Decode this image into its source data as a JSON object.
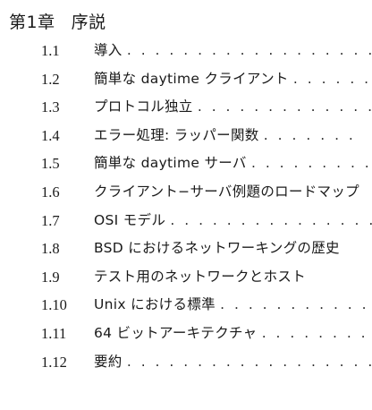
{
  "chapter": {
    "number": "第1章",
    "title": "序説"
  },
  "toc": {
    "items": [
      {
        "number": "1.1",
        "title": "導入",
        "dots": ". . . . . . . . . . . . . . . . . . . ."
      },
      {
        "number": "1.2",
        "title": "簡単な daytime クライアント",
        "dots": ". . . . . ."
      },
      {
        "number": "1.3",
        "title": "プロトコル独立",
        "dots": ". . . . . . . . . . . . . . ."
      },
      {
        "number": "1.4",
        "title": "エラー処理: ラッパー関数",
        "dots": ". . . . . . ."
      },
      {
        "number": "1.5",
        "title": "簡単な daytime サーバ",
        "dots": ". . . . . . . . . . ."
      },
      {
        "number": "1.6",
        "title": "クライアント−サーバ例題のロードマップ",
        "dots": ""
      },
      {
        "number": "1.7",
        "title": "OSI モデル",
        "dots": ". . . . . . . . . . . . . . . . . ."
      },
      {
        "number": "1.8",
        "title": "BSD におけるネットワーキングの歴史",
        "dots": ""
      },
      {
        "number": "1.9",
        "title": "テスト用のネットワークとホスト",
        "dots": ""
      },
      {
        "number": "1.10",
        "title": "Unix における標準",
        "dots": ". . . . . . . . . . . . ."
      },
      {
        "number": "1.11",
        "title": "64 ビットアーキテクチャ",
        "dots": ". . . . . . . . . ."
      },
      {
        "number": "1.12",
        "title": "要約",
        "dots": ". . . . . . . . . . . . . . . . . . . ."
      }
    ]
  }
}
